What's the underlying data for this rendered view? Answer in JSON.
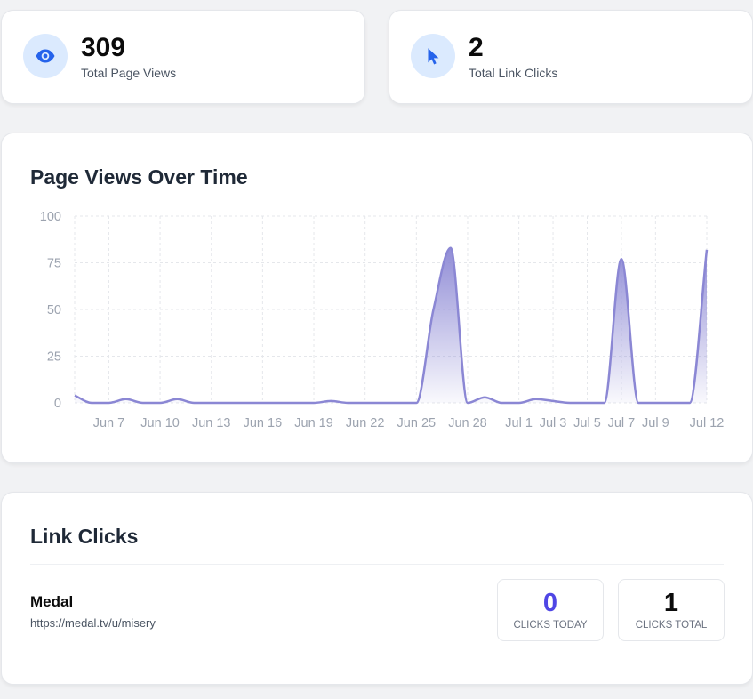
{
  "stats": [
    {
      "value": "309",
      "label": "Total Page Views",
      "icon": "eye-icon"
    },
    {
      "value": "2",
      "label": "Total Link Clicks",
      "icon": "cursor-icon"
    }
  ],
  "colors": {
    "accent": "#6366f1",
    "line": "#8b87d4",
    "icon": "#2563eb",
    "icon_bg": "#dbeafe",
    "clicks_today": "#4f46e5"
  },
  "page_views": {
    "title": "Page Views Over Time"
  },
  "chart_data": {
    "type": "area",
    "title": "Page Views Over Time",
    "xlabel": "",
    "ylabel": "",
    "ylim": [
      0,
      100
    ],
    "y_ticks": [
      0,
      25,
      50,
      75,
      100
    ],
    "grid": true,
    "x_tick_labels": [
      "Jun 7",
      "Jun 10",
      "Jun 13",
      "Jun 16",
      "Jun 19",
      "Jun 22",
      "Jun 25",
      "Jun 28",
      "Jul 1",
      "Jul 3",
      "Jul 5",
      "Jul 7",
      "Jul 9",
      "Jul 12"
    ],
    "x": [
      "Jun 5",
      "Jun 6",
      "Jun 7",
      "Jun 8",
      "Jun 9",
      "Jun 10",
      "Jun 11",
      "Jun 12",
      "Jun 13",
      "Jun 14",
      "Jun 15",
      "Jun 16",
      "Jun 17",
      "Jun 18",
      "Jun 19",
      "Jun 20",
      "Jun 21",
      "Jun 22",
      "Jun 23",
      "Jun 24",
      "Jun 25",
      "Jun 26",
      "Jun 27",
      "Jun 28",
      "Jun 29",
      "Jun 30",
      "Jul 1",
      "Jul 2",
      "Jul 3",
      "Jul 4",
      "Jul 5",
      "Jul 6",
      "Jul 7",
      "Jul 8",
      "Jul 9",
      "Jul 10",
      "Jul 11",
      "Jul 12"
    ],
    "series": [
      {
        "values": [
          4,
          0,
          0,
          2,
          0,
          0,
          2,
          0,
          0,
          0,
          0,
          0,
          0,
          0,
          0,
          1,
          0,
          0,
          0,
          0,
          0,
          50,
          83,
          0,
          3,
          0,
          0,
          2,
          1,
          0,
          0,
          0,
          77,
          0,
          0,
          0,
          0,
          82
        ]
      }
    ]
  },
  "link_clicks": {
    "title": "Link Clicks",
    "links": [
      {
        "name": "Medal",
        "url": "https://medal.tv/u/misery",
        "clicks_today": "0",
        "clicks_today_label": "CLICKS TODAY",
        "clicks_total": "1",
        "clicks_total_label": "CLICKS TOTAL"
      }
    ]
  }
}
